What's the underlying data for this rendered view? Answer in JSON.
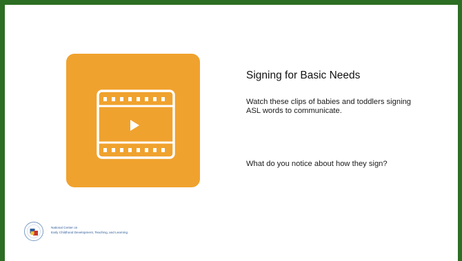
{
  "slide": {
    "title": "Signing for Basic Needs",
    "paragraph1": "Watch these clips of babies and toddlers signing ASL words to communicate.",
    "paragraph2": "What do you notice about how they sign?"
  },
  "icons": {
    "video": "video-film-icon",
    "logo": "ncecdtl-logo-icon"
  },
  "footer": {
    "org_line1": "National Center on",
    "org_line2": "Early Childhood Development, Teaching, and Learning"
  },
  "colors": {
    "frame": "#2c6e23",
    "tile": "#f0a22e",
    "icon": "#ffffff"
  }
}
